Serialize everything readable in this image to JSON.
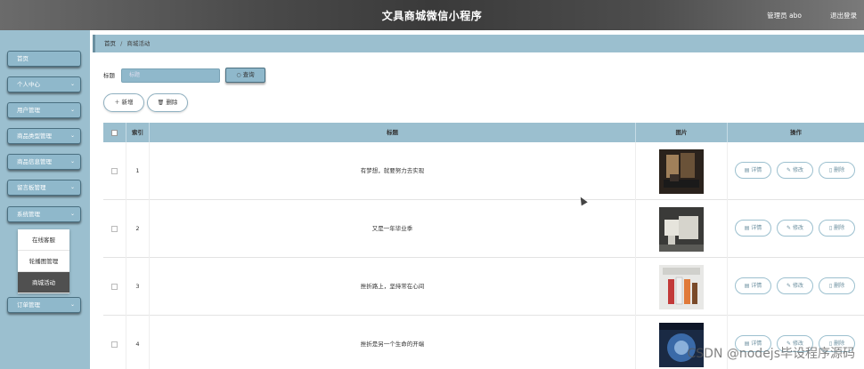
{
  "header": {
    "title": "文具商城微信小程序",
    "user_label": "管理员 abo",
    "logout_label": "退出登录"
  },
  "sidebar": {
    "items": [
      {
        "label": "首页",
        "has_chevron": false
      },
      {
        "label": "个人中心",
        "has_chevron": true
      },
      {
        "label": "用户管理",
        "has_chevron": true
      },
      {
        "label": "商品类型管理",
        "has_chevron": true
      },
      {
        "label": "商品信息管理",
        "has_chevron": true
      },
      {
        "label": "留言板管理",
        "has_chevron": true
      },
      {
        "label": "系统管理",
        "has_chevron": true
      },
      {
        "label": "订单管理",
        "has_chevron": true
      }
    ],
    "submenu": [
      {
        "label": "在线客服"
      },
      {
        "label": "轮播图管理"
      },
      {
        "label": "商城活动"
      }
    ]
  },
  "breadcrumb": {
    "home": "首页",
    "current": "商城活动"
  },
  "search": {
    "label": "标题",
    "placeholder": "标题",
    "button_label": "查询"
  },
  "actions": {
    "add_label": "新增",
    "delete_label": "删除"
  },
  "table": {
    "columns": [
      "索引",
      "标题",
      "图片",
      "操作"
    ],
    "rows": [
      {
        "index": "1",
        "title": "有梦想，就要努力去实现"
      },
      {
        "index": "2",
        "title": "又是一年毕业季"
      },
      {
        "index": "3",
        "title": "挫折路上，坚持常在心间"
      },
      {
        "index": "4",
        "title": "挫折是另一个生命的开端"
      }
    ],
    "op_labels": {
      "detail": "详情",
      "edit": "修改",
      "delete": "删除"
    }
  },
  "watermark": "CSDN @nodejs毕设程序源码",
  "colors": {
    "accent": "#9bbfcf",
    "button": "#8fb8cb"
  }
}
